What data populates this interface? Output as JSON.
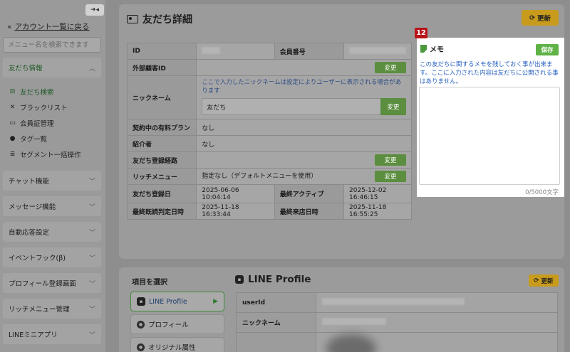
{
  "sidebar": {
    "back_label": "アカウント一覧に戻る",
    "search_placeholder": "メニュー名を検索できます",
    "friends_section": "友だち情報",
    "sub_items": [
      "友だち検索",
      "ブラックリスト",
      "会員証管理",
      "タグ一覧",
      "セグメント一括操作"
    ],
    "sections": [
      "チャット機能",
      "メッセージ機能",
      "自動応答設定",
      "イベントフック(β)",
      "プロフィール登録画面",
      "リッチメニュー管理",
      "LINEミニアプリ"
    ]
  },
  "main": {
    "title": "友だち詳細",
    "refresh_label": "更新",
    "rows": {
      "id_label": "ID",
      "member_no_label": "会員番号",
      "ext_id_label": "外部顧客ID",
      "nickname_label": "ニックネーム",
      "nickname_note": "ここで入力したニックネームは設定によりユーザーに表示される場合があります",
      "nickname_value": "友だち",
      "plan_label": "契約中の有料プラン",
      "plan_value": "なし",
      "referrer_label": "紹介者",
      "referrer_value": "なし",
      "route_label": "友だち登録経路",
      "rich_label": "リッチメニュー",
      "rich_value": "指定なし（デフォルトメニューを使用）",
      "reg_date_label": "友だち登録日",
      "reg_date_value": "2025-06-06 10:04:14",
      "last_active_label": "最終アクティブ",
      "last_active_value": "2025-12-02 16:46:15",
      "last_read_label": "最終既読判定日時",
      "last_read_value": "2025-11-18 16:33:44",
      "last_visit_label": "最終来店日時",
      "last_visit_value": "2025-11-18 16:55:25",
      "change_label": "変更"
    }
  },
  "memo": {
    "badge": "12",
    "title": "メモ",
    "save_label": "保存",
    "note": "この友だちに関するメモを残しておく事が出来ます。ここに入力された内容は友だちに公開される事はありません。",
    "count": "0/5000文字"
  },
  "lower": {
    "select_label": "項目を選択",
    "tabs": [
      "LINE Profile",
      "プロフィール",
      "オリジナル属性"
    ],
    "title": "LINE Profile",
    "refresh_label": "更新",
    "rows": [
      "userId",
      "ニックネーム"
    ]
  },
  "colors": {
    "accent_green": "#5b8e3f",
    "refresh": "#c89b1c",
    "badge": "#b8141a",
    "memo_note": "#2a62c2"
  }
}
